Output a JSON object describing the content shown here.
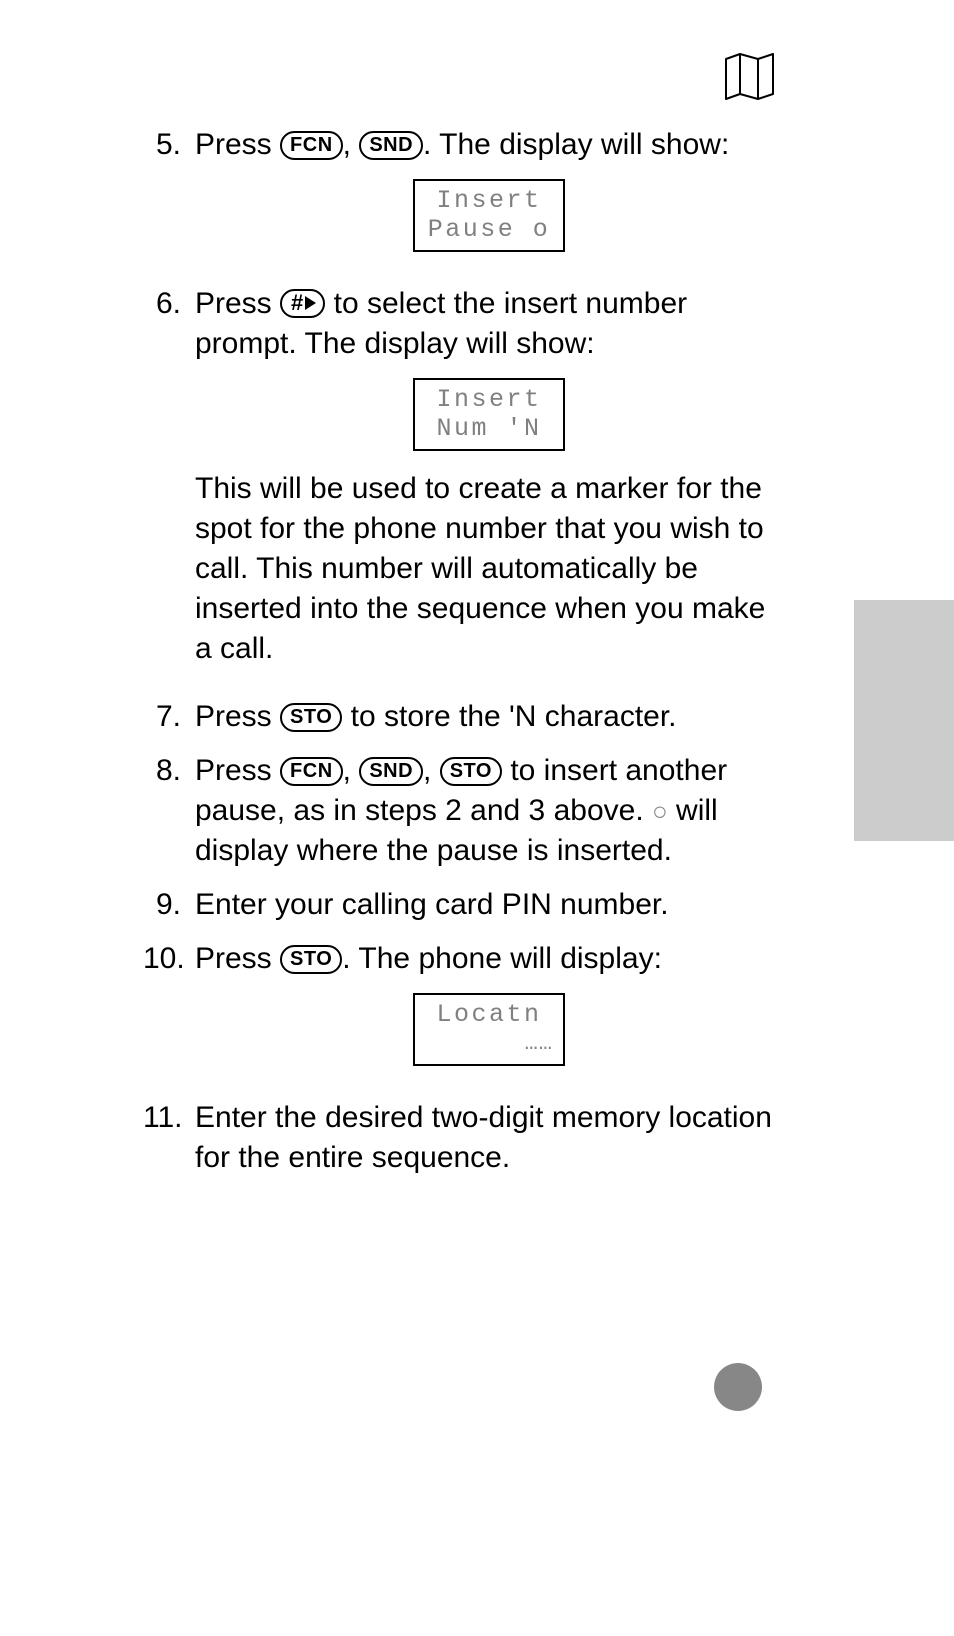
{
  "keys": {
    "fcn": "FCN",
    "snd": "SND",
    "sto": "STO",
    "hash": "#"
  },
  "displays": {
    "d1": {
      "line1": "Insert",
      "line2": "Pause o"
    },
    "d2": {
      "line1": "Insert",
      "line2": "Num 'N"
    },
    "d3": {
      "line1": "Locatn",
      "line2": "……"
    }
  },
  "steps": {
    "s5": {
      "num": "5.",
      "t1": "Press ",
      "t2": ", ",
      "t3": ". The display will show:"
    },
    "s6": {
      "num": "6.",
      "t1": "Press ",
      "t2": " to select the insert number prompt. The display will show:",
      "para": "This will be used to create a marker for the spot for the phone number that you wish to call. This number will automatically be inserted into the sequence when you make a call."
    },
    "s7": {
      "num": "7.",
      "t1": "Press ",
      "t2": " to store the 'N character."
    },
    "s8": {
      "num": "8.",
      "t1": "Press ",
      "t2": ", ",
      "t3": ", ",
      "t4": " to insert another pause, as in steps 2 and 3 above. ",
      "dot": "○",
      "t5": " will display where the pause is inserted."
    },
    "s9": {
      "num": "9.",
      "t1": "Enter your calling card PIN number."
    },
    "s10": {
      "num": "10.",
      "t1": "Press ",
      "t2": ". The phone will display:"
    },
    "s11": {
      "num": "11.",
      "t1": "Enter the desired two-digit memory location for the entire sequence."
    }
  }
}
